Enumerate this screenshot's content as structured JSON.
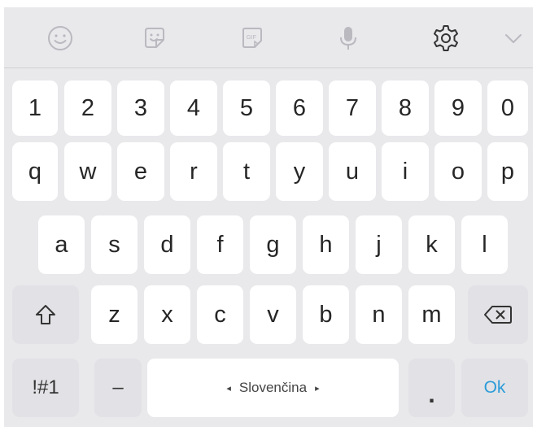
{
  "toolbar": {
    "icons": [
      "emoji-icon",
      "sticker-icon",
      "gif-icon",
      "microphone-icon",
      "settings-gear-icon",
      "collapse-chevron-icon"
    ],
    "gif_text": "GIF"
  },
  "rows": {
    "numbers": [
      "1",
      "2",
      "3",
      "4",
      "5",
      "6",
      "7",
      "8",
      "9",
      "0"
    ],
    "row1": [
      "q",
      "w",
      "e",
      "r",
      "t",
      "y",
      "u",
      "i",
      "o",
      "p"
    ],
    "row2": [
      "a",
      "s",
      "d",
      "f",
      "g",
      "h",
      "j",
      "k",
      "l"
    ],
    "row3": [
      "z",
      "x",
      "c",
      "v",
      "b",
      "n",
      "m"
    ]
  },
  "bottom": {
    "symbols_label": "!#1",
    "dash_label": "–",
    "space_label": "Slovenčina",
    "space_left_arrow": "◂",
    "space_right_arrow": "▸",
    "period_label": ".",
    "ok_label": "Ok"
  },
  "colors": {
    "background": "#e9e9ec",
    "key": "#ffffff",
    "function_key": "#e2e2e6",
    "accent": "#2b9bd8",
    "toolbar_icon": "#b9b9bf",
    "settings_icon": "#333333"
  }
}
